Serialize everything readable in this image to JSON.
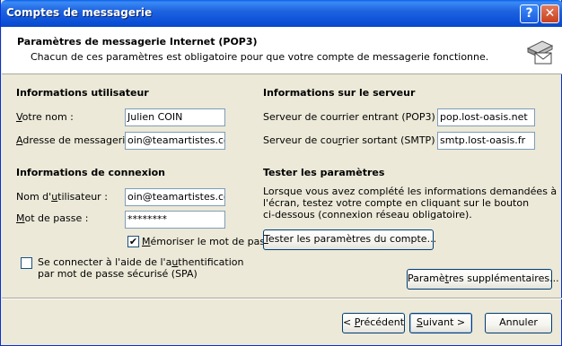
{
  "window": {
    "title": "Comptes de messagerie",
    "help_btn": "?",
    "close_btn": "✕"
  },
  "header": {
    "title": "Paramètres de messagerie Internet (POP3)",
    "subtitle": "Chacun de ces paramètres est obligatoire pour que votre compte de messagerie fonctionne.",
    "icon": "mail-server-icon"
  },
  "user_info": {
    "heading": "Informations utilisateur",
    "name_label_pre": "",
    "name_label_accel": "V",
    "name_label_post": "otre nom :",
    "name_value": "Julien COIN",
    "email_label_pre": "",
    "email_label_accel": "A",
    "email_label_post": "dresse de messagerie :",
    "email_value": "oin@teamartistes.com"
  },
  "server_info": {
    "heading": "Informations sur le serveur",
    "incoming_label_pre": "Serveur de courrier entrant (POP3) :",
    "incoming_value": "pop.lost-oasis.net",
    "outgoing_label_pre": "Serveur de cou",
    "outgoing_label_accel": "r",
    "outgoing_label_post": "rier sortant (SMTP) :",
    "outgoing_value": "smtp.lost-oasis.fr"
  },
  "connection_info": {
    "heading": "Informations de connexion",
    "user_label_pre": "Nom d'",
    "user_label_accel": "u",
    "user_label_post": "tilisateur :",
    "user_value": "oin@teamartistes.com",
    "password_label_pre": "",
    "password_label_accel": "M",
    "password_label_post": "ot de passe :",
    "password_value": "********",
    "remember_pre": "",
    "remember_accel": "M",
    "remember_post": "émoriser le mot de passe",
    "remember_checked": "✔",
    "spa_line1_pre": "Se connecter à l'aide de l'a",
    "spa_line1_accel": "u",
    "spa_line1_post": "thentification",
    "spa_line2": "par mot de passe sécurisé (SPA)",
    "spa_checked": ""
  },
  "test_settings": {
    "heading": "Tester les paramètres",
    "desc_line1": "Lorsque vous avez complété les informations demandées à",
    "desc_line2": "l'écran, testez votre compte en cliquant sur le bouton",
    "desc_line3": "ci-dessous (connexion réseau obligatoire).",
    "button_accel": "T",
    "button_post": "ester les paramètres du compte..."
  },
  "more_settings": {
    "button_pre": "Paramè",
    "button_accel": "t",
    "button_post": "res supplémentaires..."
  },
  "footer": {
    "prev_pre": "< ",
    "prev_accel": "P",
    "prev_post": "récédent",
    "next_accel": "S",
    "next_post": "uivant >",
    "cancel": "Annuler"
  },
  "colors": {
    "titlebar": "#0B4FD6",
    "dialog_bg": "#ECE9D8",
    "border": "#7F9DB9"
  }
}
